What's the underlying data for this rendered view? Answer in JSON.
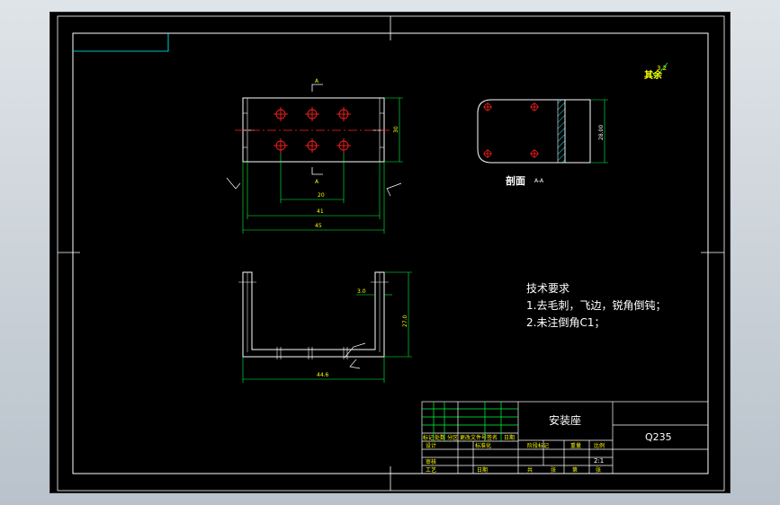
{
  "colors": {
    "background": "#000000",
    "frame": "#ffffff",
    "dimension": "#00ff40",
    "hatch": "#00ffff",
    "center_line": "#ff2020",
    "hole": "#ff2020",
    "text": "#ffffff",
    "label": "#ffff00"
  },
  "roughness_note": "其余",
  "roughness_value": "3.2",
  "top_view": {
    "section_mark_top": "A",
    "section_mark_bottom": "A",
    "dim_height": "30",
    "dim_hole_span": "20",
    "dim_inner": "41",
    "dim_overall": "45"
  },
  "section_view": {
    "title": "剖面",
    "label": "A-A",
    "dim_height": "28.00"
  },
  "front_view": {
    "dim_thickness": "3.0",
    "dim_height": "27.0",
    "dim_width": "44.6"
  },
  "technical_requirements": {
    "heading": "技术要求",
    "items": [
      "1.去毛刺，飞边，锐角倒钝；",
      "2.未注倒角C1；"
    ]
  },
  "title_block": {
    "part_name": "安装座",
    "material": "Q235",
    "scale": "2:1",
    "labels": {
      "mark": "标记",
      "count": "处数",
      "zone": "分区",
      "change_doc": "更改文件号",
      "signature": "签名",
      "date": "日期",
      "designer": "设计",
      "standardization": "标准化",
      "stage_mark": "阶段标记",
      "weight": "重量",
      "scale_label": "比例",
      "reviewer": "审核",
      "process": "工艺",
      "approve": "日期",
      "total": "共",
      "sheets": "张",
      "page": "第",
      "page_sheets": "张"
    }
  }
}
